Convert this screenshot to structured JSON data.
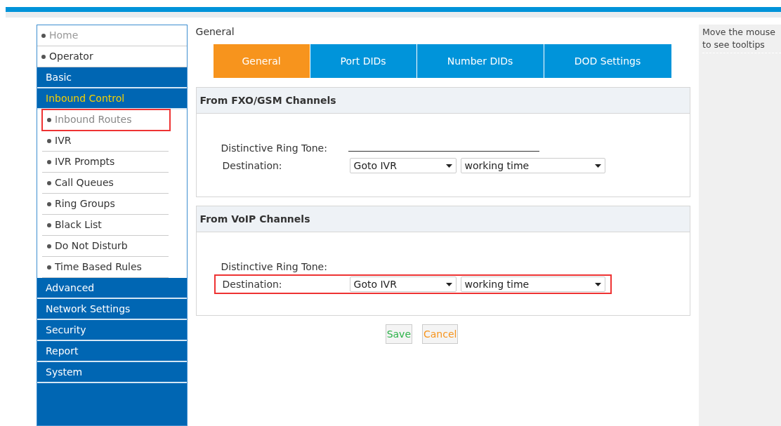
{
  "sidebar": {
    "items": [
      {
        "kind": "link",
        "label": "Home",
        "selected": false,
        "dim": true
      },
      {
        "kind": "link",
        "label": "Operator",
        "selected": false,
        "dim": false
      },
      {
        "kind": "section",
        "label": "Basic",
        "expanded": false
      },
      {
        "kind": "section",
        "label": "Inbound Control",
        "expanded": true,
        "children": [
          {
            "label": "Inbound Routes",
            "selected": true,
            "highlighted": true
          },
          {
            "label": "IVR",
            "selected": false,
            "highlighted": false
          },
          {
            "label": "IVR Prompts",
            "selected": false,
            "highlighted": false
          },
          {
            "label": "Call Queues",
            "selected": false,
            "highlighted": false
          },
          {
            "label": "Ring Groups",
            "selected": false,
            "highlighted": false
          },
          {
            "label": "Black List",
            "selected": false,
            "highlighted": false
          },
          {
            "label": "Do Not Disturb",
            "selected": false,
            "highlighted": false
          },
          {
            "label": "Time Based Rules",
            "selected": false,
            "highlighted": false
          }
        ]
      },
      {
        "kind": "section",
        "label": "Advanced",
        "expanded": false
      },
      {
        "kind": "section",
        "label": "Network Settings",
        "expanded": false
      },
      {
        "kind": "section",
        "label": "Security",
        "expanded": false
      },
      {
        "kind": "section",
        "label": "Report",
        "expanded": false
      },
      {
        "kind": "section",
        "label": "System",
        "expanded": false
      }
    ]
  },
  "page_title": "General",
  "tabs": [
    {
      "label": "General",
      "selected": true
    },
    {
      "label": "Port DIDs",
      "selected": false
    },
    {
      "label": "Number DIDs",
      "selected": false
    },
    {
      "label": "DOD Settings",
      "selected": false
    }
  ],
  "sections": [
    {
      "title": "From FXO/GSM Channels",
      "ring_tone_label": "Distinctive Ring Tone:",
      "ring_tone_field": true,
      "destination_label": "Destination:",
      "destination": "Goto IVR",
      "target": "working time",
      "highlighted": false
    },
    {
      "title": "From VoIP Channels",
      "ring_tone_label": "Distinctive Ring Tone:",
      "ring_tone_field": false,
      "destination_label": "Destination:",
      "destination": "Goto IVR",
      "target": "working time",
      "highlighted": true
    }
  ],
  "buttons": [
    {
      "kind": "save",
      "label": "Save"
    },
    {
      "kind": "cancel",
      "label": "Cancel"
    }
  ],
  "tooltip_panel": {
    "text": "Move the mouse to see tooltips"
  }
}
